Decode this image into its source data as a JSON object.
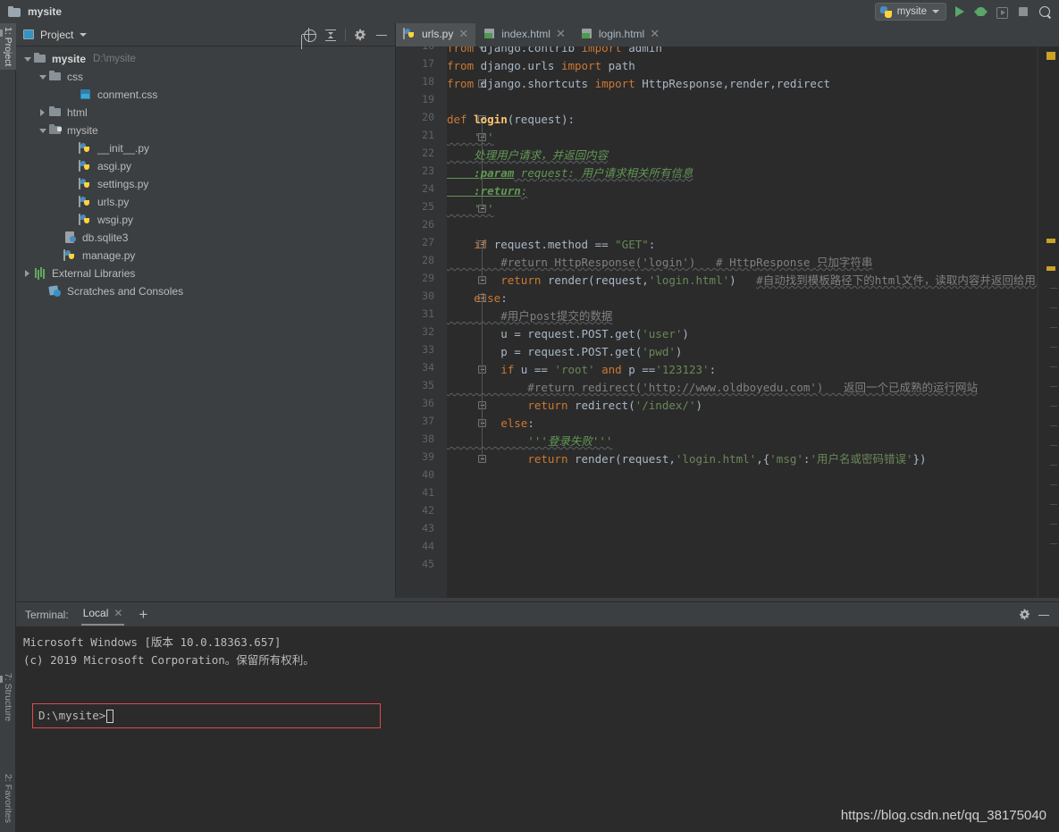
{
  "window": {
    "title": "mysite",
    "folder_icon": "folder-icon"
  },
  "toolbar": {
    "run_config_name": "mysite",
    "run_config_icon": "python-icon",
    "dropdown_icon": "chevron-down-icon",
    "buttons": [
      {
        "name": "run-button",
        "icon": "run-icon"
      },
      {
        "name": "debug-button",
        "icon": "bug-icon"
      },
      {
        "name": "coverage-button",
        "icon": "coverage-icon"
      },
      {
        "name": "stop-button",
        "icon": "stop-icon"
      },
      {
        "name": "search-everywhere-button",
        "icon": "search-icon"
      }
    ]
  },
  "left_tool_strip": {
    "tabs": [
      {
        "label": "1: Project",
        "active": true
      },
      {
        "label": "7: Structure",
        "active": false
      },
      {
        "label": "2: Favorites",
        "active": false
      }
    ]
  },
  "project_panel": {
    "title": "Project",
    "dropdown_icon": "chevron-down-icon",
    "tools": [
      {
        "name": "select-opened-file-button",
        "icon": "locate-icon"
      },
      {
        "name": "collapse-all-button",
        "icon": "collapse-all-icon"
      },
      {
        "name": "settings-button",
        "icon": "gear-icon"
      },
      {
        "name": "hide-button",
        "icon": "minimize-icon"
      }
    ],
    "tree": [
      {
        "label": "mysite",
        "path": "D:\\mysite",
        "icon": "folder-icon",
        "arrow": "down",
        "indent": 0,
        "bold": true
      },
      {
        "label": "css",
        "path": "",
        "icon": "folder-icon",
        "arrow": "down",
        "indent": 1,
        "bold": false
      },
      {
        "label": "conment.css",
        "path": "",
        "icon": "css-file-icon",
        "arrow": "none",
        "indent": 3,
        "bold": false
      },
      {
        "label": "html",
        "path": "",
        "icon": "folder-icon",
        "arrow": "right",
        "indent": 1,
        "bold": false
      },
      {
        "label": "mysite",
        "path": "",
        "icon": "module-folder-icon",
        "arrow": "down",
        "indent": 1,
        "bold": false
      },
      {
        "label": "__init__.py",
        "path": "",
        "icon": "python-file-icon",
        "arrow": "none",
        "indent": 3,
        "bold": false
      },
      {
        "label": "asgi.py",
        "path": "",
        "icon": "python-file-icon",
        "arrow": "none",
        "indent": 3,
        "bold": false
      },
      {
        "label": "settings.py",
        "path": "",
        "icon": "python-file-icon",
        "arrow": "none",
        "indent": 3,
        "bold": false
      },
      {
        "label": "urls.py",
        "path": "",
        "icon": "python-file-icon",
        "arrow": "none",
        "indent": 3,
        "bold": false
      },
      {
        "label": "wsgi.py",
        "path": "",
        "icon": "python-file-icon",
        "arrow": "none",
        "indent": 3,
        "bold": false
      },
      {
        "label": "db.sqlite3",
        "path": "",
        "icon": "database-file-icon",
        "arrow": "none",
        "indent": 2,
        "bold": false
      },
      {
        "label": "manage.py",
        "path": "",
        "icon": "python-file-icon",
        "arrow": "none",
        "indent": 2,
        "bold": false
      },
      {
        "label": "External Libraries",
        "path": "",
        "icon": "library-icon",
        "arrow": "right",
        "indent": 0,
        "bold": false
      },
      {
        "label": "Scratches and Consoles",
        "path": "",
        "icon": "scratches-icon",
        "arrow": "none",
        "indent": 1,
        "bold": false
      }
    ]
  },
  "editor": {
    "tabs": [
      {
        "label": "urls.py",
        "icon": "python-file-icon",
        "active": true,
        "close_icon": "close-icon"
      },
      {
        "label": "index.html",
        "icon": "html-file-icon",
        "active": false,
        "close_icon": "close-icon"
      },
      {
        "label": "login.html",
        "icon": "html-file-icon",
        "active": false,
        "close_icon": "close-icon"
      }
    ],
    "first_line_number": 16,
    "last_line_number": 45,
    "lines": [
      {
        "n": 16,
        "fold": "arrow",
        "segments": [
          {
            "t": "from ",
            "c": "kw"
          },
          {
            "t": "django.contrib ",
            "c": "plain"
          },
          {
            "t": "import ",
            "c": "kw"
          },
          {
            "t": "admin",
            "c": "plain"
          }
        ]
      },
      {
        "n": 17,
        "fold": "",
        "segments": [
          {
            "t": "from ",
            "c": "kw"
          },
          {
            "t": "django.urls ",
            "c": "plain"
          },
          {
            "t": "import ",
            "c": "kw"
          },
          {
            "t": "path",
            "c": "plain"
          }
        ]
      },
      {
        "n": 18,
        "fold": "mark",
        "segments": [
          {
            "t": "from ",
            "c": "kw"
          },
          {
            "t": "django.shortcuts ",
            "c": "plain"
          },
          {
            "t": "import ",
            "c": "kw"
          },
          {
            "t": "HttpResponse",
            "c": "plain"
          },
          {
            "t": ",",
            "c": "plain"
          },
          {
            "t": "render",
            "c": "plain"
          },
          {
            "t": ",",
            "c": "plain"
          },
          {
            "t": "redirect",
            "c": "plain"
          }
        ]
      },
      {
        "n": 19,
        "fold": "",
        "segments": []
      },
      {
        "n": 20,
        "fold": "mark",
        "segments": [
          {
            "t": "def ",
            "c": "kw"
          },
          {
            "t": "login",
            "c": "fn"
          },
          {
            "t": "(request):",
            "c": "plain"
          }
        ]
      },
      {
        "n": 21,
        "fold": "mark",
        "segments": [
          {
            "t": "    '''",
            "c": "doc"
          }
        ]
      },
      {
        "n": 22,
        "fold": "",
        "segments": [
          {
            "t": "    处理用户请求，并返回内容",
            "c": "doc"
          }
        ]
      },
      {
        "n": 23,
        "fold": "",
        "segments": [
          {
            "t": "    :param",
            "c": "doctag"
          },
          {
            "t": " request: ",
            "c": "doc"
          },
          {
            "t": "用户请求相关所有信息",
            "c": "doc"
          }
        ]
      },
      {
        "n": 24,
        "fold": "",
        "segments": [
          {
            "t": "    :return",
            "c": "doctag"
          },
          {
            "t": ":",
            "c": "doc"
          }
        ]
      },
      {
        "n": 25,
        "fold": "mark",
        "segments": [
          {
            "t": "    '''",
            "c": "doc"
          }
        ]
      },
      {
        "n": 26,
        "fold": "",
        "segments": []
      },
      {
        "n": 27,
        "fold": "mark",
        "segments": [
          {
            "t": "    ",
            "c": "plain"
          },
          {
            "t": "if ",
            "c": "kw"
          },
          {
            "t": "request.method == ",
            "c": "plain"
          },
          {
            "t": "\"GET\"",
            "c": "str"
          },
          {
            "t": ":",
            "c": "plain"
          }
        ]
      },
      {
        "n": 28,
        "fold": "",
        "segments": [
          {
            "t": "        #return HttpResponse('login')   # HttpResponse 只加字符串",
            "c": "cmt"
          }
        ]
      },
      {
        "n": 29,
        "fold": "mark",
        "segments": [
          {
            "t": "        ",
            "c": "plain"
          },
          {
            "t": "return ",
            "c": "kw"
          },
          {
            "t": "render(request",
            "c": "plain"
          },
          {
            "t": ",",
            "c": "plain"
          },
          {
            "t": "'login.html'",
            "c": "str"
          },
          {
            "t": ")   ",
            "c": "plain"
          },
          {
            "t": "#自动找到模板路径下的html文件，读取内容并返回给用户",
            "c": "cmt"
          }
        ]
      },
      {
        "n": 30,
        "fold": "mark",
        "segments": [
          {
            "t": "    ",
            "c": "plain"
          },
          {
            "t": "else",
            "c": "kw"
          },
          {
            "t": ":",
            "c": "plain"
          }
        ]
      },
      {
        "n": 31,
        "fold": "",
        "segments": [
          {
            "t": "        #用户post提交的数据",
            "c": "cmt"
          }
        ]
      },
      {
        "n": 32,
        "fold": "",
        "segments": [
          {
            "t": "        u = request.POST.get(",
            "c": "plain"
          },
          {
            "t": "'user'",
            "c": "str"
          },
          {
            "t": ")",
            "c": "plain"
          }
        ]
      },
      {
        "n": 33,
        "fold": "",
        "segments": [
          {
            "t": "        p = request.POST.get(",
            "c": "plain"
          },
          {
            "t": "'pwd'",
            "c": "str"
          },
          {
            "t": ")",
            "c": "plain"
          }
        ]
      },
      {
        "n": 34,
        "fold": "mark",
        "segments": [
          {
            "t": "        ",
            "c": "plain"
          },
          {
            "t": "if ",
            "c": "kw"
          },
          {
            "t": "u == ",
            "c": "plain"
          },
          {
            "t": "'root' ",
            "c": "str"
          },
          {
            "t": "and ",
            "c": "kw"
          },
          {
            "t": "p ==",
            "c": "plain"
          },
          {
            "t": "'123123'",
            "c": "str"
          },
          {
            "t": ":",
            "c": "plain"
          }
        ]
      },
      {
        "n": 35,
        "fold": "",
        "segments": [
          {
            "t": "            #return redirect('http://www.oldboyedu.com')   返回一个已成熟的运行网站",
            "c": "cmt"
          }
        ]
      },
      {
        "n": 36,
        "fold": "mark",
        "segments": [
          {
            "t": "            ",
            "c": "plain"
          },
          {
            "t": "return ",
            "c": "kw"
          },
          {
            "t": "redirect(",
            "c": "plain"
          },
          {
            "t": "'/index/'",
            "c": "str"
          },
          {
            "t": ")",
            "c": "plain"
          }
        ]
      },
      {
        "n": 37,
        "fold": "mark",
        "segments": [
          {
            "t": "        ",
            "c": "plain"
          },
          {
            "t": "else",
            "c": "kw"
          },
          {
            "t": ":",
            "c": "plain"
          }
        ]
      },
      {
        "n": 38,
        "fold": "",
        "segments": [
          {
            "t": "            '''登录失败'''",
            "c": "doc"
          }
        ]
      },
      {
        "n": 39,
        "fold": "mark",
        "segments": [
          {
            "t": "            ",
            "c": "plain"
          },
          {
            "t": "return ",
            "c": "kw"
          },
          {
            "t": "render(request",
            "c": "plain"
          },
          {
            "t": ",",
            "c": "plain"
          },
          {
            "t": "'login.html'",
            "c": "str"
          },
          {
            "t": ",",
            "c": "plain"
          },
          {
            "t": "{",
            "c": "plain"
          },
          {
            "t": "'msg'",
            "c": "str"
          },
          {
            "t": ":",
            "c": "plain"
          },
          {
            "t": "'用户名或密码错误'",
            "c": "str"
          },
          {
            "t": "})",
            "c": "plain"
          }
        ]
      },
      {
        "n": 40,
        "fold": "",
        "segments": []
      },
      {
        "n": 41,
        "fold": "",
        "segments": []
      },
      {
        "n": 42,
        "fold": "",
        "segments": []
      },
      {
        "n": 43,
        "fold": "",
        "segments": []
      },
      {
        "n": 44,
        "fold": "",
        "segments": []
      },
      {
        "n": 45,
        "fold": "",
        "segments": []
      }
    ]
  },
  "terminal": {
    "label": "Terminal:",
    "tab_label": "Local",
    "tab_close_icon": "close-icon",
    "add_icon": "plus-icon",
    "tools": [
      {
        "name": "terminal-settings-button",
        "icon": "gear-icon"
      },
      {
        "name": "terminal-hide-button",
        "icon": "minimize-icon"
      }
    ],
    "output_lines": [
      "Microsoft Windows [版本 10.0.18363.657]",
      "(c) 2019 Microsoft Corporation。保留所有权利。"
    ],
    "prompt": "D:\\mysite>"
  },
  "watermark": "https://blog.csdn.net/qq_38175040",
  "colors": {
    "background": "#3c3f41",
    "editor_background": "#2b2b2b",
    "gutter": "#313335",
    "keyword": "#cc7832",
    "string": "#6a8759",
    "comment": "#808080",
    "docstring": "#629755",
    "function": "#ffc66d",
    "text": "#a9b7c6",
    "accent_red": "#e04a4a",
    "run_green": "#59a869"
  }
}
